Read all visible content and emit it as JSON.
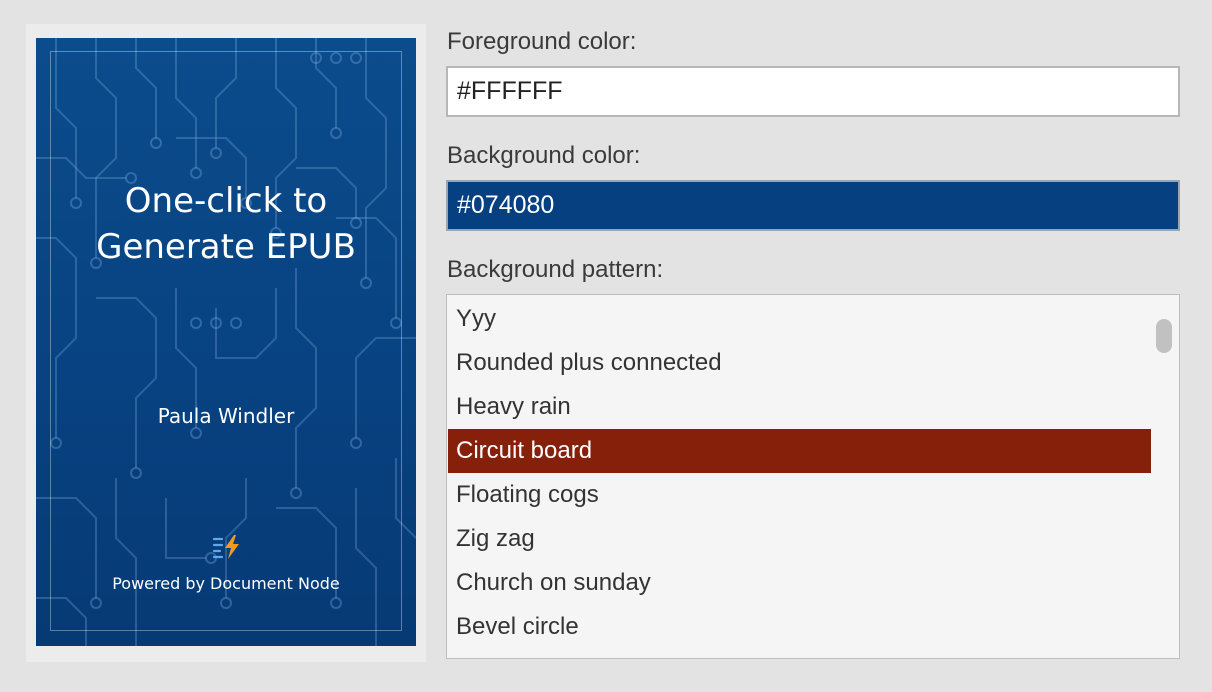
{
  "cover": {
    "title_line1": "One-click to",
    "title_line2": "Generate EPUB",
    "author": "Paula Windler",
    "powered_by": "Powered by Document Node",
    "logo_icon": "document-node-logo-icon"
  },
  "form": {
    "foreground_label": "Foreground color:",
    "foreground_value": "#FFFFFF",
    "background_label": "Background color:",
    "background_value": "#074080",
    "pattern_label": "Background pattern:"
  },
  "pattern_list": {
    "items": [
      {
        "label": "Yyy"
      },
      {
        "label": "Rounded plus connected"
      },
      {
        "label": "Heavy rain"
      },
      {
        "label": "Circuit board"
      },
      {
        "label": "Floating cogs"
      },
      {
        "label": "Zig zag"
      },
      {
        "label": "Church on sunday"
      },
      {
        "label": "Bevel circle"
      }
    ],
    "selected_index": 3
  },
  "colors": {
    "cover_background": "#074080",
    "selection": "#86200A",
    "foreground": "#FFFFFF"
  }
}
